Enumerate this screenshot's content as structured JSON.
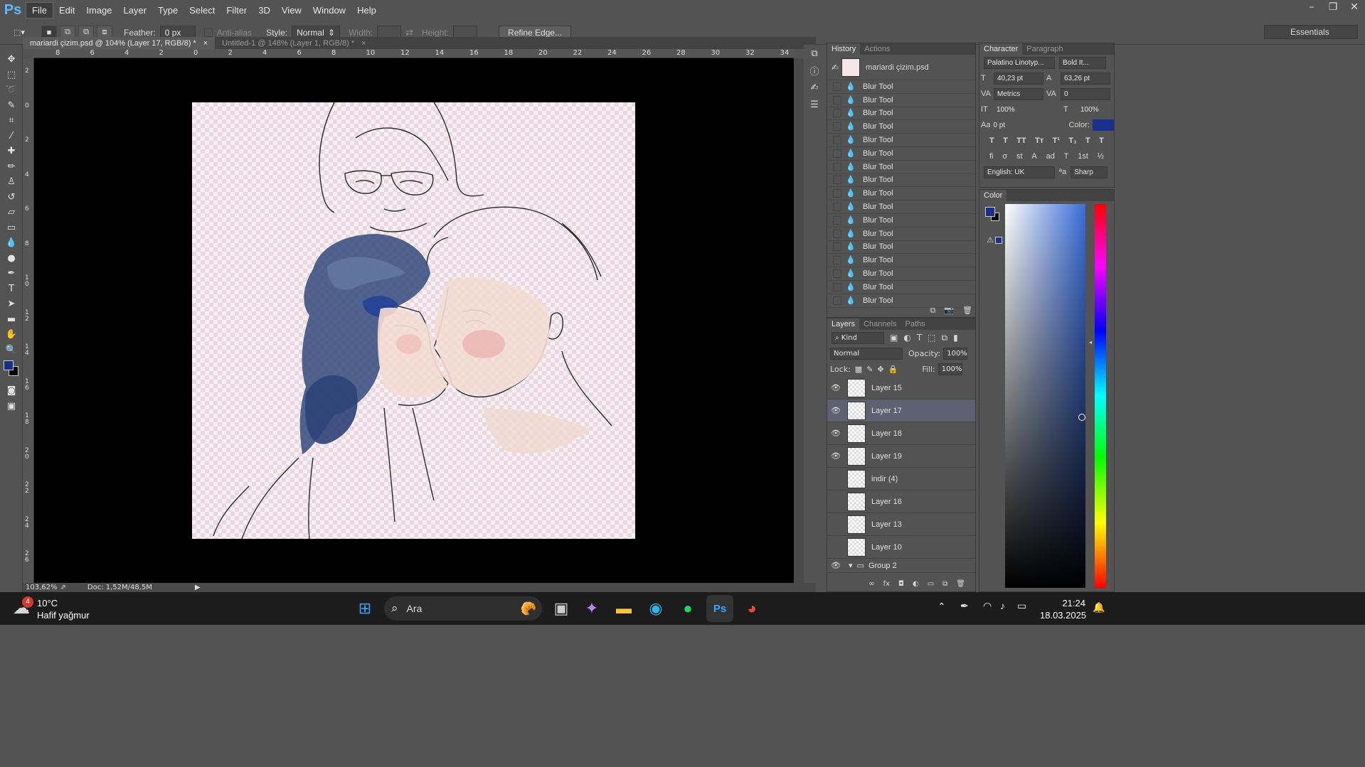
{
  "menubar": {
    "logo": "Ps",
    "items": [
      "File",
      "Edit",
      "Image",
      "Layer",
      "Type",
      "Select",
      "Filter",
      "3D",
      "View",
      "Window",
      "Help"
    ],
    "window_controls": [
      "–",
      "❐",
      "✕"
    ]
  },
  "options": {
    "feather_label": "Feather:",
    "feather_value": "0 px",
    "antialias_label": "Anti-alias",
    "style_label": "Style:",
    "style_value": "Normal",
    "width_label": "Width:",
    "height_label": "Height:",
    "refine_edge": "Refine Edge...",
    "workspace": "Essentials"
  },
  "doc_tabs": [
    {
      "label": "mariardi çizim.psd @ 104% (Layer 17, RGB/8) *",
      "close": "×"
    },
    {
      "label": "Untitled-1 @ 148% (Layer 1, RGB/8) *",
      "close": "×"
    }
  ],
  "ruler_h_labels": [
    "8",
    "6",
    "4",
    "2",
    "0",
    "2",
    "4",
    "6",
    "8",
    "10",
    "12",
    "14",
    "16",
    "18",
    "20",
    "22",
    "24",
    "26",
    "28",
    "30",
    "32",
    "34"
  ],
  "ruler_v_labels": [
    "2",
    "0",
    "2",
    "4",
    "6",
    "8",
    "1 0",
    "1 2",
    "1 4",
    "1 6",
    "1 8",
    "2 0",
    "2 2",
    "2 4",
    "2 6"
  ],
  "status": {
    "zoom": "103,62%",
    "doc": "Doc: 1,52M/48,5M"
  },
  "history": {
    "tabs": [
      "History",
      "Actions"
    ],
    "snapshot": "mariardi çizim.psd",
    "items": [
      "Blur Tool",
      "Blur Tool",
      "Blur Tool",
      "Blur Tool",
      "Blur Tool",
      "Blur Tool",
      "Blur Tool",
      "Blur Tool",
      "Blur Tool",
      "Blur Tool",
      "Blur Tool",
      "Blur Tool",
      "Blur Tool",
      "Blur Tool",
      "Blur Tool",
      "Blur Tool",
      "Blur Tool"
    ]
  },
  "layers": {
    "tabs": [
      "Layers",
      "Channels",
      "Paths"
    ],
    "kind": "Kind",
    "blend_mode": "Normal",
    "opacity_label": "Opacity:",
    "opacity": "100%",
    "lock_label": "Lock:",
    "fill_label": "Fill:",
    "fill": "100%",
    "rows": [
      {
        "name": "Layer 15",
        "visible": true,
        "selected": false
      },
      {
        "name": "Layer 17",
        "visible": true,
        "selected": true
      },
      {
        "name": "Layer 18",
        "visible": true,
        "selected": false
      },
      {
        "name": "Layer 19",
        "visible": true,
        "selected": false
      },
      {
        "name": "indir (4)",
        "visible": false,
        "selected": false
      },
      {
        "name": "Layer 16",
        "visible": false,
        "selected": false
      },
      {
        "name": "Layer 13",
        "visible": false,
        "selected": false
      },
      {
        "name": "Layer 10",
        "visible": false,
        "selected": false
      }
    ],
    "group": "Group 2"
  },
  "character": {
    "tabs": [
      "Character",
      "Paragraph"
    ],
    "font": "Palatino Linotyp...",
    "style": "Bold It...",
    "size": "40,23 pt",
    "leading": "63,26 pt",
    "kerning": "Metrics",
    "tracking": "0",
    "v_scale": "100%",
    "h_scale": "100%",
    "baseline": "0 pt",
    "color_label": "Color:",
    "language": "English: UK",
    "aa_label": "ªa",
    "antialias": "Sharp",
    "type_buttons": [
      "T",
      "T",
      "TT",
      "Tт",
      "T¹",
      "T₁",
      "T",
      "T"
    ],
    "ot_buttons": [
      "fi",
      "σ",
      "st",
      "A",
      "ad",
      "T",
      "1st",
      "½"
    ]
  },
  "color_panel": {
    "title": "Color",
    "fg": "#1a2f8a",
    "hue": "#3a6cd6"
  },
  "colors": {
    "fg_swatch": "#14307e"
  },
  "taskbar": {
    "weather_temp": "10°C",
    "weather_desc": "Hafif yağmur",
    "weather_badge": "4",
    "search": "Ara",
    "time": "21:24",
    "date": "18.03.2025"
  }
}
